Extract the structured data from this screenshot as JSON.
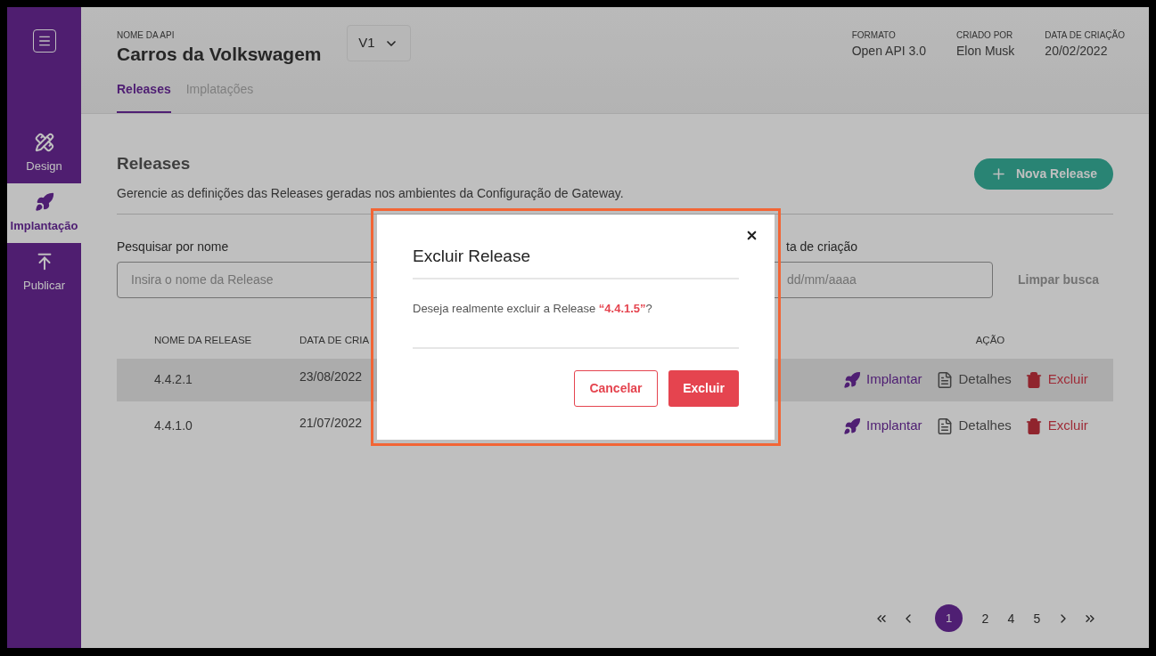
{
  "sidebar": {
    "items": [
      {
        "label": "Design",
        "selected": false
      },
      {
        "label": "Implantação",
        "selected": true
      },
      {
        "label": "Publicar",
        "selected": false
      }
    ]
  },
  "header": {
    "api_label": "NOME DA API",
    "api_name": "Carros da Volkswagem",
    "version": "V1",
    "meta": [
      {
        "label": "FORMATO",
        "value": "Open API 3.0"
      },
      {
        "label": "CRIADO POR",
        "value": "Elon Musk"
      },
      {
        "label": "DATA DE CRIAÇÃO",
        "value": "20/02/2022"
      }
    ]
  },
  "tabs": [
    {
      "label": "Releases",
      "selected": true
    },
    {
      "label": "Implatações",
      "selected": false
    }
  ],
  "section": {
    "title": "Releases",
    "description": "Gerencie as definições das Releases geradas nos ambientes da Configuração de Gateway.",
    "new_button": "Nova Release"
  },
  "filters": [
    {
      "label": "Pesquisar por nome",
      "placeholder": "Insira o nome da Release"
    },
    {
      "label": "ta de criação",
      "placeholder": "dd/mm/aaaa"
    }
  ],
  "clear_button": "Limpar busca",
  "table": {
    "columns": [
      "NOME DA RELEASE",
      "DATA DE CRIA",
      "AÇÃO"
    ],
    "rows": [
      {
        "name": "4.4.2.1",
        "date": "23/08/2022",
        "selected": true,
        "actions": [
          {
            "kind": "deploy",
            "label": "Implantar"
          },
          {
            "kind": "details",
            "label": "Detalhes"
          },
          {
            "kind": "delete",
            "label": "Excluir"
          }
        ]
      },
      {
        "name": "4.4.1.0",
        "date": "21/07/2022",
        "selected": false,
        "actions": [
          {
            "kind": "deploy",
            "label": "Implantar"
          },
          {
            "kind": "details",
            "label": "Detalhes"
          },
          {
            "kind": "delete",
            "label": "Excluir"
          }
        ]
      }
    ]
  },
  "pagination": {
    "pages": [
      {
        "label": "1",
        "selected": true
      },
      {
        "label": "2",
        "selected": false
      },
      {
        "label": "4",
        "selected": false
      },
      {
        "label": "5",
        "selected": false
      }
    ]
  },
  "dialog": {
    "title": "Excluir Release",
    "message": "Deseja realmente excluir a Release **“4.4.1.5”**?",
    "cancel": "Cancelar",
    "confirm": "Excluir"
  }
}
